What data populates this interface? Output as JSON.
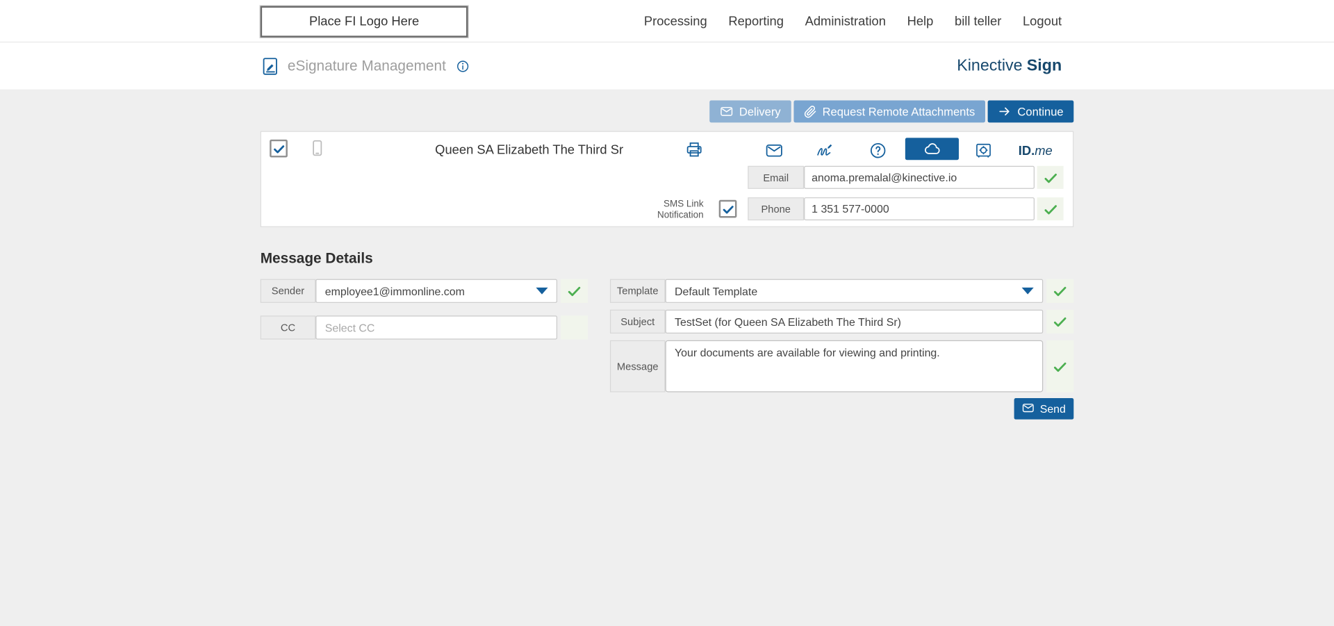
{
  "topbar": {
    "logo_placeholder": "Place FI Logo Here",
    "nav": [
      "Processing",
      "Reporting",
      "Administration",
      "Help",
      "bill teller",
      "Logout"
    ]
  },
  "header": {
    "title": "eSignature Management",
    "brand": {
      "regular": "Kinective",
      "bold": "Sign"
    }
  },
  "actions": {
    "delivery": "Delivery",
    "request_remote_attachments": "Request Remote Attachments",
    "continue": "Continue"
  },
  "recipient": {
    "name": "Queen SA Elizabeth The Third Sr",
    "email": {
      "label": "Email",
      "value": "anoma.premalal@kinective.io"
    },
    "phone": {
      "label": "Phone",
      "value": "1 351 577-0000"
    },
    "sms_notification": {
      "line1": "SMS Link",
      "line2": "Notification"
    },
    "idme": {
      "bold": "ID.",
      "italic": "me"
    }
  },
  "message_details": {
    "heading": "Message Details",
    "sender": {
      "label": "Sender",
      "value": "employee1@immonline.com"
    },
    "cc": {
      "label": "CC",
      "placeholder": "Select CC"
    },
    "template": {
      "label": "Template",
      "value": "Default Template"
    },
    "subject": {
      "label": "Subject",
      "value": "TestSet (for Queen SA Elizabeth The Third Sr)"
    },
    "message": {
      "label": "Message",
      "value": "Your documents are available for viewing and printing."
    },
    "send": "Send"
  },
  "colors": {
    "primary_blue": "#15609d",
    "brand_navy": "#17486d",
    "light_blue_button": "#8fb2d4",
    "medium_blue_button": "#79a5d1",
    "success_green": "#4caf50",
    "page_background": "#efefef"
  }
}
